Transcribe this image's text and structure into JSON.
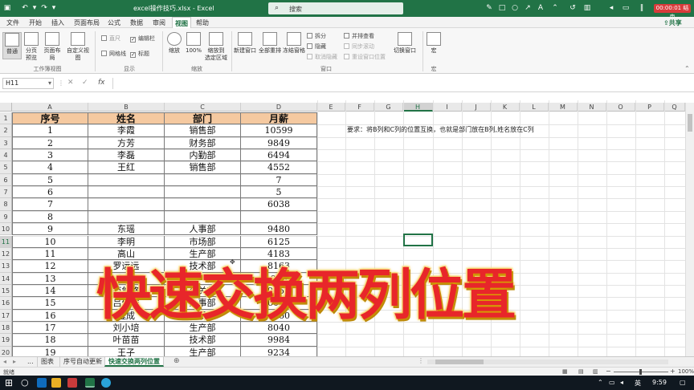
{
  "titlebar": {
    "filename": "excel操作技巧.xlsx",
    "separator": "-",
    "app": "Excel",
    "search_placeholder": "搜索",
    "timer": "00:00:01",
    "timer_action": "结束"
  },
  "menu": {
    "items": [
      "文件",
      "开始",
      "插入",
      "页面布局",
      "公式",
      "数据",
      "审阅",
      "视图",
      "帮助"
    ],
    "active": "视图",
    "share": "共享"
  },
  "ribbon": {
    "workbook_views": [
      "普通",
      "分页\n预览",
      "页面布局",
      "自定义视图"
    ],
    "show": {
      "ruler": "直尺",
      "formula_bar": "编辑栏",
      "gridlines": "网格线",
      "headings": "标题"
    },
    "zoom": [
      "缩放",
      "100%",
      "缩放到\n选定区域"
    ],
    "window": [
      "新建窗口",
      "全部重排",
      "冻结窗格"
    ],
    "window_small": [
      "拆分",
      "隐藏",
      "取消隐藏",
      "并排查看",
      "同步滚动",
      "重设窗口位置"
    ],
    "switch_window": "切换窗口",
    "macros": "宏",
    "groups": [
      "工作簿视图",
      "显示",
      "缩放",
      "窗口",
      "宏"
    ]
  },
  "formulabar": {
    "name_box": "H11",
    "fx": "fx",
    "value": ""
  },
  "sheet": {
    "columns": [
      "A",
      "B",
      "C",
      "D",
      "E",
      "F",
      "G",
      "H",
      "I",
      "J",
      "K",
      "L",
      "M",
      "N",
      "O",
      "P",
      "Q"
    ],
    "headers": [
      "序号",
      "姓名",
      "部门",
      "月薪"
    ],
    "rows": [
      [
        "1",
        "李霞",
        "销售部",
        "10599"
      ],
      [
        "2",
        "方芳",
        "财务部",
        "9849"
      ],
      [
        "3",
        "李磊",
        "内勤部",
        "6494"
      ],
      [
        "4",
        "王红",
        "销售部",
        "4552"
      ],
      [
        "5",
        "",
        "",
        "7"
      ],
      [
        "6",
        "",
        "",
        "5"
      ],
      [
        "7",
        "",
        "",
        "6038"
      ],
      [
        "8",
        "",
        "",
        ""
      ],
      [
        "9",
        "东瑶",
        "人事部",
        "9480"
      ],
      [
        "10",
        "李明",
        "市场部",
        "6125"
      ],
      [
        "11",
        "高山",
        "生产部",
        "4183"
      ],
      [
        "12",
        "罗远远",
        "技术部",
        "8163"
      ],
      [
        "13",
        "刘浩",
        "生产部",
        "10107"
      ],
      [
        "14",
        "范悠悠",
        "公关部",
        "9357"
      ],
      [
        "15",
        "吕依依",
        "人事部",
        "6002"
      ],
      [
        "16",
        "程成",
        "市场部",
        "4060"
      ],
      [
        "17",
        "刘小培",
        "生产部",
        "8040"
      ],
      [
        "18",
        "叶苗苗",
        "技术部",
        "9984"
      ],
      [
        "19",
        "王子",
        "生产部",
        "9234"
      ]
    ],
    "note": "要求：将B列和C列的位置互换，也就是部门放在B列,姓名放在C列",
    "overlay_title": "快速交换两列位置",
    "selected_cell": "H11"
  },
  "tabs": {
    "items": [
      "...",
      "图表",
      "序号自动更新",
      "快速交换两列位置"
    ],
    "active": "快速交换两列位置"
  },
  "status": {
    "mode": "就绪",
    "zoom": "100%"
  },
  "taskbar": {
    "time": "9:59",
    "ime": "英"
  }
}
